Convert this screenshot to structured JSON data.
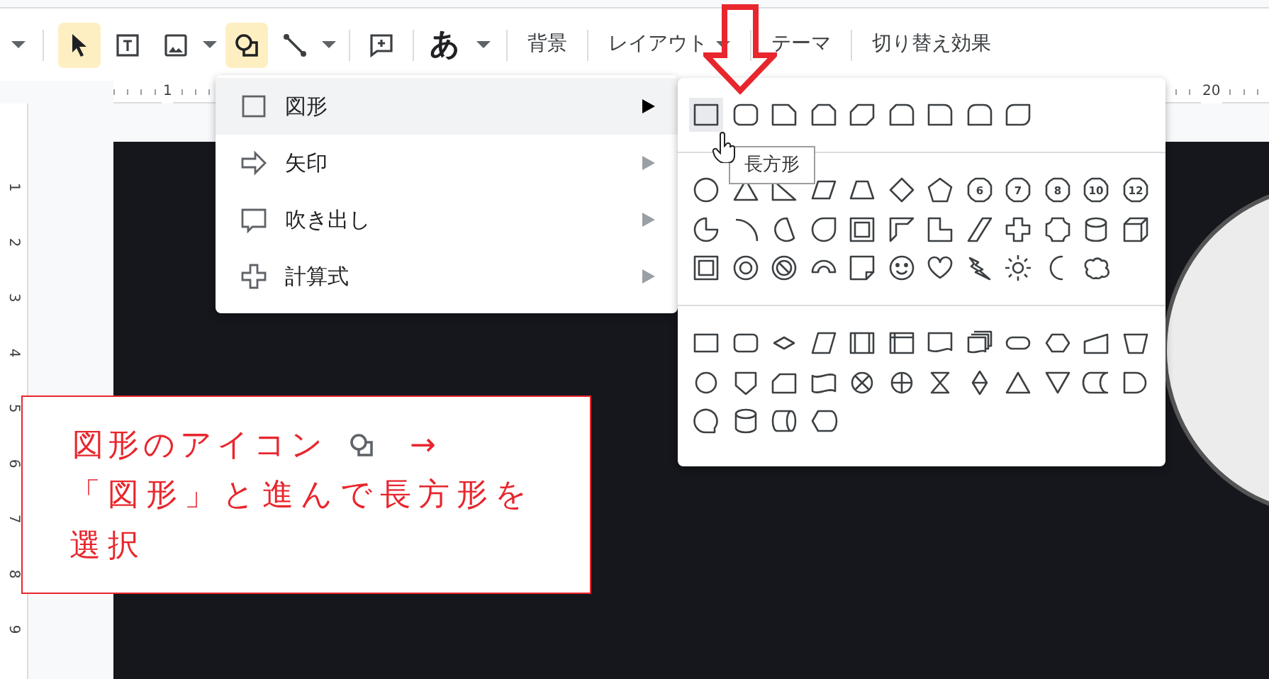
{
  "toolbar": {
    "tools": [
      {
        "kind": "select",
        "selected": true,
        "dropdown": false
      },
      {
        "kind": "textbox",
        "selected": false,
        "dropdown": false
      },
      {
        "kind": "image",
        "selected": false,
        "dropdown": true
      },
      {
        "kind": "shape",
        "selected": true,
        "dropdown": false
      },
      {
        "kind": "line",
        "selected": false,
        "dropdown": true
      },
      {
        "kind": "comment",
        "selected": false,
        "dropdown": false
      }
    ],
    "font_button": "あ",
    "menus": [
      {
        "label": "背景",
        "dropdown": false
      },
      {
        "label": "レイアウト",
        "dropdown": true
      },
      {
        "label": "テーマ",
        "dropdown": false
      },
      {
        "label": "切り替え効果",
        "dropdown": false
      }
    ]
  },
  "ruler": {
    "horizontal_labels": [
      "1",
      "20"
    ],
    "vertical_labels": [
      "1",
      "2",
      "3",
      "4",
      "5",
      "6",
      "7",
      "8",
      "9"
    ]
  },
  "insert_menu": {
    "items": [
      {
        "kind": "shape",
        "label": "図形",
        "selected": true
      },
      {
        "kind": "arrow",
        "label": "矢印",
        "selected": false
      },
      {
        "kind": "callout",
        "label": "吹き出し",
        "selected": false
      },
      {
        "kind": "equation",
        "label": "計算式",
        "selected": false
      }
    ]
  },
  "shape_sections": [
    {
      "rows": [
        {
          "shapes": [
            {
              "kind": "rectangle",
              "hovered": true
            },
            {
              "kind": "rounded-rectangle",
              "hovered": false
            },
            {
              "kind": "snip-corner",
              "hovered": false
            },
            {
              "kind": "snip-two-corners",
              "hovered": false
            },
            {
              "kind": "snip-diagonal",
              "hovered": false
            },
            {
              "kind": "snip-round",
              "hovered": false
            },
            {
              "kind": "round-corner",
              "hovered": false
            },
            {
              "kind": "round-two-corners",
              "hovered": false
            },
            {
              "kind": "round-diagonal",
              "hovered": false
            }
          ]
        }
      ]
    },
    {
      "rows": [
        {
          "shapes": [
            {
              "kind": "oval",
              "hovered": false
            },
            {
              "kind": "triangle",
              "hovered": false
            },
            {
              "kind": "right-triangle",
              "hovered": false
            },
            {
              "kind": "parallelogram",
              "hovered": false
            },
            {
              "kind": "trapezoid",
              "hovered": false
            },
            {
              "kind": "diamond",
              "hovered": false
            },
            {
              "kind": "pentagon",
              "hovered": false
            },
            {
              "kind": "polygon",
              "label": "6",
              "hovered": false
            },
            {
              "kind": "polygon",
              "label": "7",
              "hovered": false
            },
            {
              "kind": "polygon",
              "label": "8",
              "hovered": false
            },
            {
              "kind": "polygon",
              "label": "10",
              "hovered": false
            },
            {
              "kind": "polygon",
              "label": "12",
              "hovered": false
            }
          ]
        },
        {
          "shapes": [
            {
              "kind": "pie",
              "hovered": false
            },
            {
              "kind": "arc",
              "hovered": false
            },
            {
              "kind": "chord",
              "hovered": false
            },
            {
              "kind": "teardrop",
              "hovered": false
            },
            {
              "kind": "frame",
              "hovered": false
            },
            {
              "kind": "half-frame",
              "hovered": false
            },
            {
              "kind": "l-shape",
              "hovered": false
            },
            {
              "kind": "diagonal-stripe",
              "hovered": false
            },
            {
              "kind": "cross",
              "hovered": false
            },
            {
              "kind": "plaque",
              "hovered": false
            },
            {
              "kind": "can",
              "hovered": false
            },
            {
              "kind": "cube",
              "hovered": false
            }
          ]
        },
        {
          "shapes": [
            {
              "kind": "bevel",
              "hovered": false
            },
            {
              "kind": "donut",
              "hovered": false
            },
            {
              "kind": "no-symbol",
              "hovered": false
            },
            {
              "kind": "block-arc",
              "hovered": false
            },
            {
              "kind": "folded-corner",
              "hovered": false
            },
            {
              "kind": "smiley",
              "hovered": false
            },
            {
              "kind": "heart",
              "hovered": false
            },
            {
              "kind": "lightning",
              "hovered": false
            },
            {
              "kind": "sun",
              "hovered": false
            },
            {
              "kind": "moon",
              "hovered": false
            },
            {
              "kind": "cloud",
              "hovered": false
            }
          ]
        }
      ]
    },
    {
      "rows": [
        {
          "shapes": [
            {
              "kind": "process",
              "hovered": false
            },
            {
              "kind": "alternate-process",
              "hovered": false
            },
            {
              "kind": "decision",
              "hovered": false
            },
            {
              "kind": "data",
              "hovered": false
            },
            {
              "kind": "predefined-process",
              "hovered": false
            },
            {
              "kind": "internal-storage",
              "hovered": false
            },
            {
              "kind": "document",
              "hovered": false
            },
            {
              "kind": "multidocument",
              "hovered": false
            },
            {
              "kind": "terminator",
              "hovered": false
            },
            {
              "kind": "preparation",
              "hovered": false
            },
            {
              "kind": "manual-input",
              "hovered": false
            },
            {
              "kind": "manual-operation",
              "hovered": false
            }
          ]
        },
        {
          "shapes": [
            {
              "kind": "connector",
              "hovered": false
            },
            {
              "kind": "off-page-connector",
              "hovered": false
            },
            {
              "kind": "card",
              "hovered": false
            },
            {
              "kind": "punched-tape",
              "hovered": false
            },
            {
              "kind": "summing-junction",
              "hovered": false
            },
            {
              "kind": "or",
              "hovered": false
            },
            {
              "kind": "collate",
              "hovered": false
            },
            {
              "kind": "sort",
              "hovered": false
            },
            {
              "kind": "extract",
              "hovered": false
            },
            {
              "kind": "merge",
              "hovered": false
            },
            {
              "kind": "stored-data",
              "hovered": false
            },
            {
              "kind": "delay",
              "hovered": false
            }
          ]
        },
        {
          "shapes": [
            {
              "kind": "sequential-storage",
              "hovered": false
            },
            {
              "kind": "magnetic-disk",
              "hovered": false
            },
            {
              "kind": "direct-access-storage",
              "hovered": false
            },
            {
              "kind": "display",
              "hovered": false
            }
          ]
        }
      ]
    }
  ],
  "tooltip": "長方形",
  "annotation": {
    "line_1": "図形のアイコン",
    "arrow": "→",
    "text": "「図形」と進んで長方形を選択"
  }
}
